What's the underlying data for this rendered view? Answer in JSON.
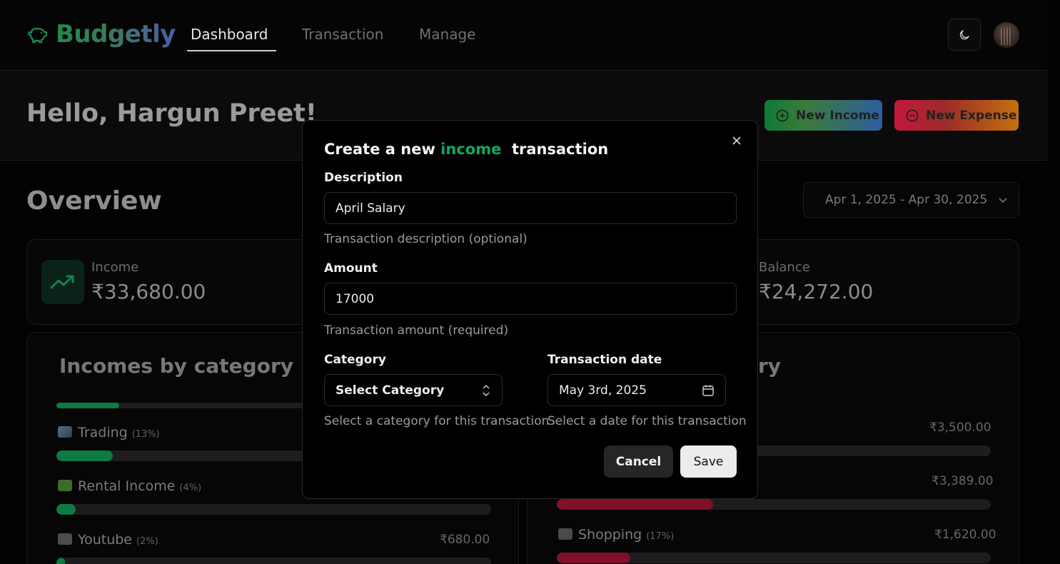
{
  "nav": {
    "brand": "Budgetly",
    "links": [
      "Dashboard",
      "Transaction",
      "Manage"
    ],
    "active": "Dashboard",
    "theme_icon": "moon-icon",
    "avatar_icon": "user-avatar"
  },
  "header": {
    "greeting": "Hello, Hargun Preet!",
    "new_income": "New Income",
    "new_expense": "New Expense"
  },
  "overview": {
    "title": "Overview",
    "date_range": "Apr 1, 2025 - Apr 30, 2025"
  },
  "stats": {
    "income_label": "Income",
    "income_value": "₹33,680.00",
    "balance_label": "Balance",
    "balance_value": "₹24,272.00"
  },
  "incomes_by_category": {
    "title": "Incomes by category",
    "items": [
      {
        "label": "Trading",
        "pct": "(13%)",
        "amount": "",
        "fill": 0.13
      },
      {
        "label": "Rental Income",
        "pct": "(4%)",
        "amount": "",
        "fill": 0.04
      },
      {
        "label": "Youtube",
        "pct": "(2%)",
        "amount": "₹680.00",
        "fill": 0.02
      }
    ]
  },
  "expenses_by_category": {
    "title_visible": "ry",
    "items": [
      {
        "label": "",
        "pct": "",
        "amount": "₹3,500.00",
        "fill": 0.36
      },
      {
        "label": "",
        "pct": "",
        "amount": "₹3,389.00",
        "fill": 0.36
      },
      {
        "label": "Shopping",
        "pct": "(17%)",
        "amount": "₹1,620.00",
        "fill": 0.17
      }
    ]
  },
  "modal": {
    "title_prefix": "Create a new ",
    "title_type": "income",
    "title_suffix": "  transaction",
    "description_label": "Description",
    "description_value": "April Salary",
    "description_help": "Transaction description (optional)",
    "amount_label": "Amount",
    "amount_value": "17000",
    "amount_help": "Transaction amount (required)",
    "category_label": "Category",
    "category_value": "Select Category",
    "category_help": "Select a category for this transaction",
    "date_label": "Transaction date",
    "date_value": "May 3rd, 2025",
    "date_help": "Select a date for this transaction",
    "cancel": "Cancel",
    "save": "Save"
  },
  "colors": {
    "income_accent": "#12a862",
    "expense_bar": "#7e1028",
    "income_bar": "#0f7a44"
  }
}
